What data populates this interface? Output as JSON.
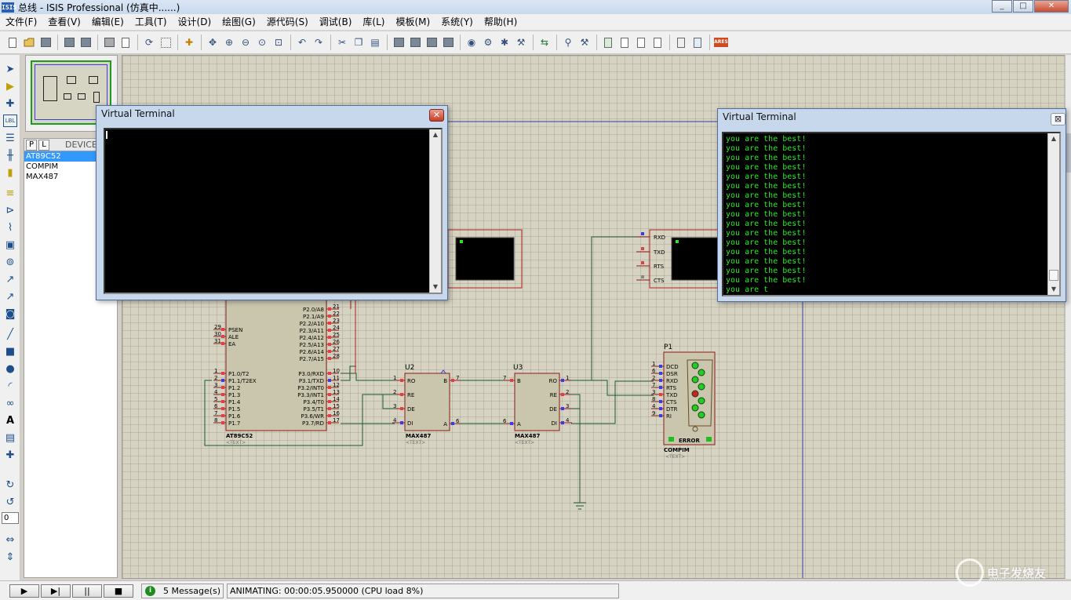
{
  "app": {
    "icon_label": "ISIS",
    "title": "总线 - ISIS Professional (仿真中......)"
  },
  "window_controls": [
    "_",
    "□",
    "✕"
  ],
  "menu": [
    "文件(F)",
    "查看(V)",
    "编辑(E)",
    "工具(T)",
    "设计(D)",
    "绘图(G)",
    "源代码(S)",
    "调试(B)",
    "库(L)",
    "模板(M)",
    "系统(Y)",
    "帮助(H)"
  ],
  "toolbar_icons": [
    "new-file-icon",
    "open-folder-icon",
    "save-icon",
    "import-icon",
    "export-icon",
    "print-icon",
    "print-setup-icon",
    "refresh-icon",
    "grid-icon",
    "origin-icon",
    "pan-icon",
    "zoom-in-icon",
    "zoom-out-icon",
    "zoom-all-icon",
    "zoom-area-icon",
    "undo-icon",
    "redo-icon",
    "cut-icon",
    "copy-icon",
    "paste-icon",
    "block-copy-icon",
    "block-move-icon",
    "block-rotate-icon",
    "block-delete-icon",
    "pick-device-icon",
    "make-device-icon",
    "package-icon",
    "decompose-icon",
    "wire-autorouter-icon",
    "search-icon",
    "property-tool-icon",
    "netlist-icon",
    "bom-icon",
    "erc-icon",
    "drc-icon",
    "netlist-ares-icon",
    "export-ares-icon",
    "ares-icon"
  ],
  "ares_label": "ARES",
  "left_tools": [
    "selection-mode-icon",
    "component-mode-icon",
    "junction-icon",
    "wire-label-icon",
    "text-script-icon",
    "bus-icon",
    "subcircuit-icon",
    "terminal-icon",
    "device-pin-icon",
    "graph-icon",
    "tape-recorder-icon",
    "generator-icon",
    "voltage-probe-icon",
    "current-probe-icon",
    "virtual-instrument-icon",
    "line-icon",
    "box-icon",
    "circle-icon",
    "arc-icon",
    "path-icon",
    "text-icon",
    "symbol-icon",
    "marker-icon",
    "rotate-cw-icon",
    "rotate-ccw-icon",
    "mirror-x-icon",
    "mirror-y-icon"
  ],
  "rotation_value": "0",
  "device_panel": {
    "tab_p": "P",
    "tab_l": "L",
    "title": "DEVICE",
    "items": [
      {
        "label": "AT89C52",
        "selected": true
      },
      {
        "label": "COMPIM",
        "selected": false
      },
      {
        "label": "MAX487",
        "selected": false
      }
    ]
  },
  "schematic": {
    "mcu": {
      "name": "AT89C52",
      "text": "<TEXT>",
      "left_pins": [
        {
          "no": "29",
          "name": "PSEN"
        },
        {
          "no": "30",
          "name": "ALE"
        },
        {
          "no": "31",
          "name": "EA"
        }
      ],
      "p1_pins": [
        {
          "no": "1",
          "name": "P1.0/T2"
        },
        {
          "no": "2",
          "name": "P1.1/T2EX"
        },
        {
          "no": "3",
          "name": "P1.2"
        },
        {
          "no": "4",
          "name": "P1.3"
        },
        {
          "no": "5",
          "name": "P1.4"
        },
        {
          "no": "6",
          "name": "P1.5"
        },
        {
          "no": "7",
          "name": "P1.6"
        },
        {
          "no": "8",
          "name": "P1.7"
        }
      ],
      "p2_pins": [
        {
          "no": "21",
          "name": "P2.0/A8"
        },
        {
          "no": "22",
          "name": "P2.1/A9"
        },
        {
          "no": "23",
          "name": "P2.2/A10"
        },
        {
          "no": "24",
          "name": "P2.3/A11"
        },
        {
          "no": "25",
          "name": "P2.4/A12"
        },
        {
          "no": "26",
          "name": "P2.5/A13"
        },
        {
          "no": "27",
          "name": "P2.6/A14"
        },
        {
          "no": "28",
          "name": "P2.7/A15"
        }
      ],
      "p3_pins": [
        {
          "no": "10",
          "name": "P3.0/RXD"
        },
        {
          "no": "11",
          "name": "P3.1/TXD"
        },
        {
          "no": "12",
          "name": "P3.2/INT0"
        },
        {
          "no": "13",
          "name": "P3.3/INT1"
        },
        {
          "no": "14",
          "name": "P3.4/T0"
        },
        {
          "no": "15",
          "name": "P3.5/T1"
        },
        {
          "no": "16",
          "name": "P3.6/WR"
        },
        {
          "no": "17",
          "name": "P3.7/RD"
        }
      ]
    },
    "u2": {
      "ref": "U2",
      "name": "MAX487",
      "text": "<TEXT>",
      "left_pins": [
        {
          "no": "1",
          "name": "RO"
        },
        {
          "no": "2",
          "name": "RE"
        },
        {
          "no": "3",
          "name": "DE"
        },
        {
          "no": "4",
          "name": "DI"
        }
      ],
      "right_pins": [
        {
          "no": "7",
          "name": "B"
        },
        {
          "no": "6",
          "name": "A"
        }
      ]
    },
    "u3": {
      "ref": "U3",
      "name": "MAX487",
      "text": "<TEXT>",
      "left_pins": [
        {
          "no": "7",
          "name": "B"
        },
        {
          "no": "6",
          "name": "A"
        }
      ],
      "right_pins": [
        {
          "no": "1",
          "name": "RO"
        },
        {
          "no": "2",
          "name": "RE"
        },
        {
          "no": "3",
          "name": "DE"
        },
        {
          "no": "4",
          "name": "DI"
        }
      ]
    },
    "p1": {
      "ref": "P1",
      "name": "COMPIM",
      "text": "<TEXT>",
      "error": "ERROR",
      "pins": [
        {
          "no": "1",
          "name": "DCD"
        },
        {
          "no": "6",
          "name": "DSR"
        },
        {
          "no": "2",
          "name": "RXD"
        },
        {
          "no": "7",
          "name": "RTS"
        },
        {
          "no": "3",
          "name": "TXD"
        },
        {
          "no": "8",
          "name": "CTS"
        },
        {
          "no": "4",
          "name": "DTR"
        },
        {
          "no": "9",
          "name": "RI"
        }
      ]
    },
    "vterm_pins": [
      "RXD",
      "TXD",
      "RTS",
      "CTS"
    ]
  },
  "terminal_left": {
    "title": "Virtual Terminal",
    "close_label": "✕",
    "lines": []
  },
  "terminal_right": {
    "title": "Virtual Terminal",
    "close_label": "⊠",
    "lines": [
      "you are the best!",
      "you are the best!",
      "you are the best!",
      "you are the best!",
      "you are the best!",
      "you are the best!",
      "you are the best!",
      "you are the best!",
      "you are the best!",
      "you are the best!",
      "you are the best!",
      "you are the best!",
      "you are the best!",
      "you are the best!",
      "you are the best!",
      "you are the best!",
      "you are t"
    ]
  },
  "status": {
    "messages": "5 Message(s)",
    "animating": "ANIMATING: 00:00:05.950000 (CPU load 8%)"
  },
  "playback": {
    "play": "▶",
    "step": "▶|",
    "pause": "||",
    "stop": "■"
  },
  "watermark": {
    "text": "电子发烧友",
    "sub": "www.elecfans.com"
  },
  "colors": {
    "wire": "#1e5a32",
    "chip_border": "#8b1a1a",
    "chip_fill": "#c9c6ad",
    "terminal_text": "#26e826",
    "canvas_bg": "#d7d3c2",
    "sheet_border": "#3a3aa8"
  }
}
